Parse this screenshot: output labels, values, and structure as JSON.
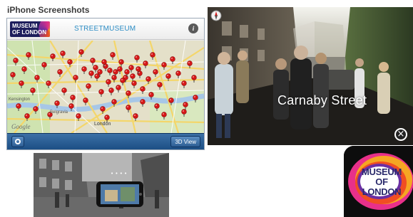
{
  "section": {
    "title": "iPhone Screenshots"
  },
  "map_screen": {
    "logo_line1": "MUSEUM",
    "logo_line2": "OF LONDON",
    "brand": "STREETMUSEUM",
    "info_label": "i",
    "view_button": "3D View",
    "google_mark": "Google",
    "place_labels": [
      "Kensington",
      "Belgravia",
      "London"
    ],
    "pin_color": "#d61818",
    "toolbar_color": "#1c4f85",
    "icons": [
      "info-icon",
      "locate-icon",
      "map-pin-icon"
    ]
  },
  "street_screen": {
    "caption": "Carnaby Street",
    "close_label": "×",
    "icons": [
      "compass-icon",
      "close-icon"
    ]
  },
  "ar_screen": {
    "dots": "• • • •"
  },
  "app_icon": {
    "line1": "MUSEUM",
    "line2": "OF LONDON",
    "accent_colors": [
      "#e8308a",
      "#f5a623",
      "#f04e23",
      "#6b2fa3"
    ]
  }
}
